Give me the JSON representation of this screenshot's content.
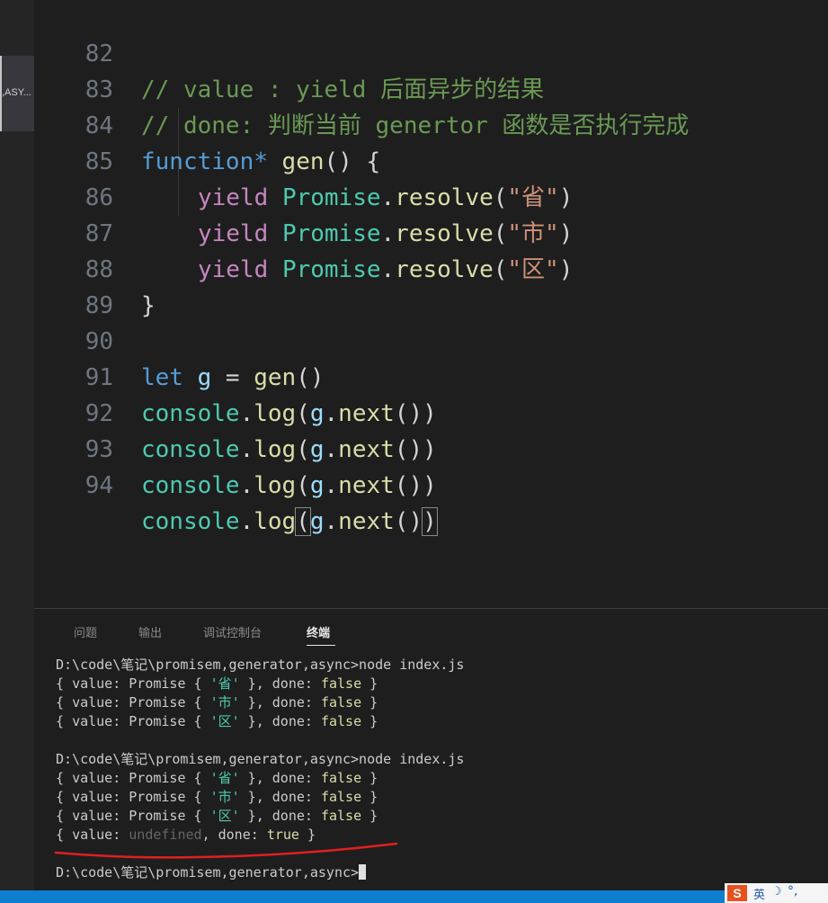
{
  "explorer": {
    "tab_label": ",ASY..."
  },
  "editor": {
    "lines": [
      {
        "num": "82",
        "comment": "// value : yield 后面异步的结果"
      },
      {
        "num": "83",
        "comment": "// done: 判断当前 genertor 函数是否执行完成"
      },
      {
        "num": "84",
        "kw": "function*",
        "name": "gen",
        "rest": "() {"
      },
      {
        "num": "85",
        "ctrl": "yield",
        "cls": "Promise",
        "method": "resolve",
        "str": "\"省\""
      },
      {
        "num": "86",
        "ctrl": "yield",
        "cls": "Promise",
        "method": "resolve",
        "str": "\"市\""
      },
      {
        "num": "87",
        "ctrl": "yield",
        "cls": "Promise",
        "method": "resolve",
        "str": "\"区\""
      },
      {
        "num": "88",
        "text": "}"
      },
      {
        "num": "89",
        "text": ""
      },
      {
        "num": "90",
        "kw": "let",
        "var": "g",
        "op": " = ",
        "call": "gen",
        "rest": "()"
      },
      {
        "num": "91",
        "obj": "console",
        "fn": "log",
        "arg": "g",
        "next": "next"
      },
      {
        "num": "92",
        "obj": "console",
        "fn": "log",
        "arg": "g",
        "next": "next"
      },
      {
        "num": "93",
        "obj": "console",
        "fn": "log",
        "arg": "g",
        "next": "next"
      },
      {
        "num": "94",
        "obj": "console",
        "fn": "log",
        "arg": "g",
        "next": "next"
      }
    ]
  },
  "panel": {
    "tabs": [
      "问题",
      "输出",
      "调试控制台",
      "终端"
    ],
    "active_tab": "终端"
  },
  "terminal": {
    "prompt": "D:\\code\\笔记\\promisem,generator,async>",
    "command": "node index.js",
    "value_key": "value",
    "promise_word": "Promise",
    "done_key": "done",
    "false_word": "false",
    "true_word": "true",
    "undefined_word": "undefined",
    "values": [
      "'省'",
      "'市'",
      "'区'"
    ]
  },
  "taskbar": {
    "ime_logo": "S",
    "ime_lang": "英",
    "ime_moon": "☽",
    "ime_punct": "°,"
  },
  "colors": {
    "underline": "#e0201f",
    "status_bar": "#0e7fcf",
    "comment": "#6a9955",
    "keyword": "#569cd6",
    "class": "#4ec9b0",
    "string": "#ce9178"
  }
}
